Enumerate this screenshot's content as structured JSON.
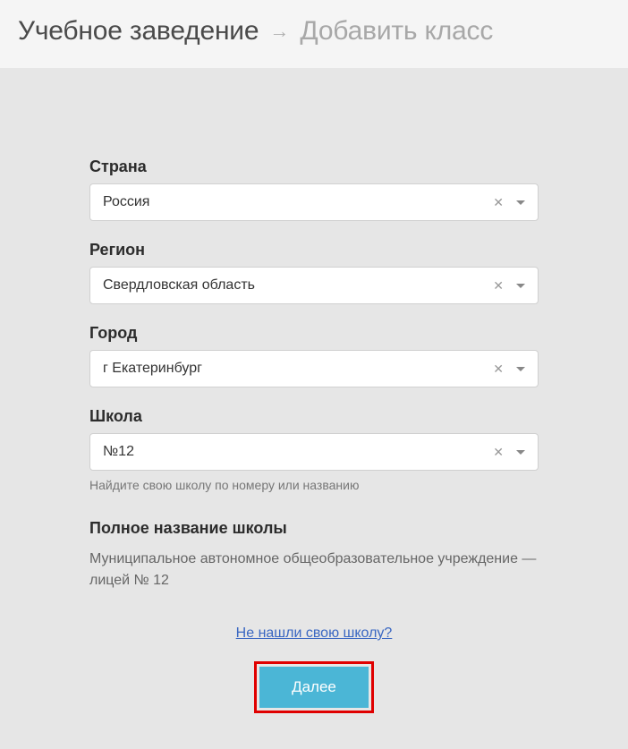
{
  "header": {
    "title": "Учебное заведение",
    "subtitle": "Добавить класс"
  },
  "fields": {
    "country": {
      "label": "Страна",
      "value": "Россия"
    },
    "region": {
      "label": "Регион",
      "value": "Свердловская область"
    },
    "city": {
      "label": "Город",
      "value": "г Екатеринбург"
    },
    "school": {
      "label": "Школа",
      "value": "№12",
      "hint": "Найдите свою школу по номеру или названию"
    }
  },
  "fullname": {
    "label": "Полное название школы",
    "text": "Муниципальное автономное общеобразовательное учреждение — лицей № 12"
  },
  "footer": {
    "link": "Не нашли свою школу?",
    "button": "Далее"
  }
}
